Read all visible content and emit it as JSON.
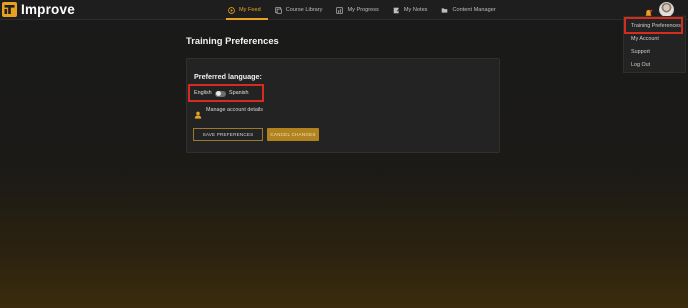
{
  "app": {
    "name": "Improve"
  },
  "nav": {
    "items": [
      {
        "label": "My Feed",
        "icon": "play-circle-icon",
        "active": true
      },
      {
        "label": "Course Library",
        "icon": "library-icon",
        "active": false
      },
      {
        "label": "My Progress",
        "icon": "progress-icon",
        "active": false
      },
      {
        "label": "My Notes",
        "icon": "notes-icon",
        "active": false
      },
      {
        "label": "Content Manager",
        "icon": "folder-icon",
        "active": false
      }
    ]
  },
  "user_menu": {
    "items": [
      {
        "label": "Training Preferences",
        "highlighted": true
      },
      {
        "label": "My Account"
      },
      {
        "label": "Support"
      },
      {
        "label": "Log Out"
      }
    ]
  },
  "page": {
    "title": "Training Preferences",
    "preferred_language_label": "Preferred language:",
    "language_left": "English",
    "language_right": "Spanish",
    "toggle_state": "off",
    "manage_link": "Manage account details",
    "save_button": "SAVE PREFERENCES",
    "cancel_button": "CANCEL CHANGES"
  },
  "colors": {
    "accent": "#e9a21f",
    "highlight_box": "#d62b1f",
    "background": "#1a1a1a",
    "card": "#232323",
    "cancel_button_bg": "#b0831f"
  }
}
